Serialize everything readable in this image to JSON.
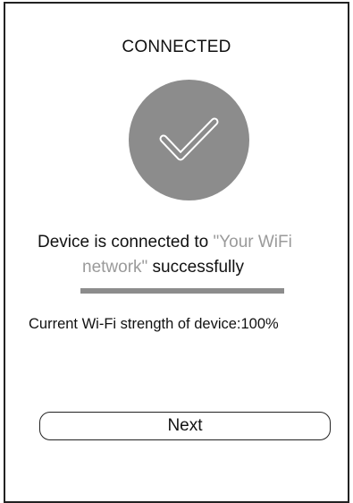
{
  "header": {
    "title": "CONNECTED"
  },
  "status_icon": {
    "icon": "checkmark-icon",
    "circle_color": "#8c8c8c",
    "check_color": "#ffffff"
  },
  "message": {
    "prefix": "Device is connected to ",
    "network": "\"Your WiFi",
    "network_cont": "network\"",
    "suffix": " successfully",
    "network_color": "#9a9a9a"
  },
  "progress": {
    "value": 1.0,
    "fill_color": "#8c8c8c"
  },
  "signal": {
    "text": "Current Wi-Fi strength of device:100%"
  },
  "actions": {
    "next_label": "Next"
  }
}
